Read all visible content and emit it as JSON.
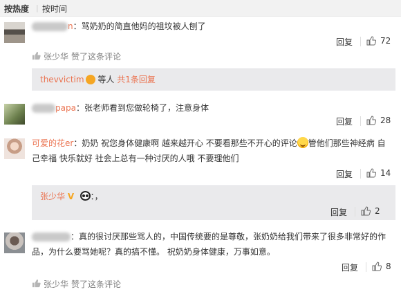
{
  "sortbar": {
    "hot_label": "按热度",
    "separator": "|",
    "time_label": "按时间"
  },
  "comments": [
    {
      "username_suffix": "n",
      "colon": "：",
      "text": "骂奶奶的简直他妈的祖坟被人刨了",
      "reply_label": "回复",
      "like_count": "72",
      "liked_by": "张少华",
      "liked_suffix": "赞了这条评论",
      "subreply": {
        "user": "thevvictim",
        "others": "等人",
        "count_text": "共1条回复"
      }
    },
    {
      "username_suffix": "papa",
      "colon": "：",
      "text": "张老师看到您做轮椅了，注意身体",
      "reply_label": "回复",
      "like_count": "28"
    },
    {
      "username": "可爱的花er",
      "colon": "：",
      "text_line1_a": "奶奶 祝您身体健康啊 越来越开心 不要看那些不开心的评论",
      "text_line1_b": "管他们那些神经病 自",
      "text_line2": "己幸福 快乐就好 社会上总有一种讨厌的人哦 不要理他们",
      "reply_label": "回复",
      "like_count": "14",
      "subreply": {
        "user": "张少华",
        "text": "：，",
        "reply_label": "回复",
        "like_count": "2"
      }
    },
    {
      "colon": "：",
      "text_line1": "真的很讨厌那些骂人的，中国传统要的是尊敬，张奶奶给我们带来了很多非常好的作",
      "text_line2": "品，为什么要骂她呢？真的搞不懂。 祝奶奶身体健康，万事如意。",
      "reply_label": "回复",
      "like_count": "8",
      "liked_by": "张少华",
      "liked_suffix": "赞了这条评论"
    }
  ]
}
